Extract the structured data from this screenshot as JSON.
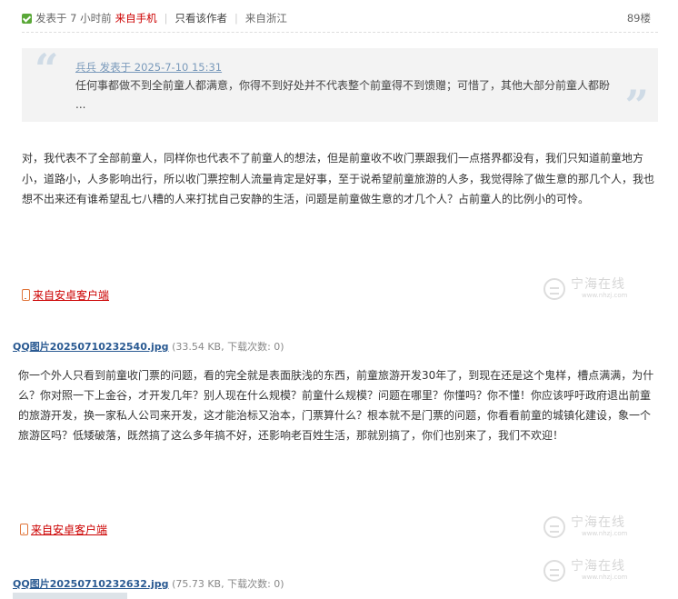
{
  "post_meta": {
    "posted_time": "发表于 7 小时前",
    "from_mobile": "来自手机",
    "only_author": "只看该作者",
    "location": "来自浙江",
    "floor": "89楼"
  },
  "quote": {
    "author": "兵兵 发表于 2025-7-10 15:31",
    "text": "任何事都做不到全前童人都满意，你得不到好处并不代表整个前童得不到馈赠；可惜了，其他大部分前童人都盼 ..."
  },
  "post_body": "对，我代表不了全部前童人，同样你也代表不了前童人的想法，但是前童收不收门票跟我们一点搭界都没有，我们只知道前童地方小，道路小，人多影响出行，所以收门票控制人流量肯定是好事，至于说希望前童旅游的人多，我觉得除了做生意的那几个人，我也想不出来还有谁希望乱七八糟的人来打扰自己安静的生活，问题是前童做生意的才几个人？占前童人的比例小的可怜。",
  "client_link_1": "来自安卓客户端",
  "watermark": {
    "main": "宁海在线",
    "sub": "www.nhzj.com"
  },
  "attachment_1": {
    "name": "QQ图片20250710232540.jpg",
    "info": "(33.54 KB, 下载次数: 0)"
  },
  "reply_body": "你一个外人只看到前童收门票的问题，看的完全就是表面肤浅的东西，前童旅游开发30年了，到现在还是这个鬼样，槽点满满，为什么？你对照一下上金谷，才开发几年？别人现在什么规模？前童什么规模？问题在哪里？你懂吗？你不懂！你应该呼吁政府退出前童的旅游开发，换一家私人公司来开发，这才能治标又治本，门票算什么？根本就不是门票的问题，你看看前童的城镇化建设，象一个旅游区吗？低矮破落，既然搞了这么多年搞不好，还影响老百姓生活，那就别搞了，你们也别来了，我们不欢迎！",
  "client_link_2": "来自安卓客户端",
  "attachment_2": {
    "name": "QQ图片20250710232632.jpg",
    "info": "(75.73 KB, 下载次数: 0)"
  }
}
